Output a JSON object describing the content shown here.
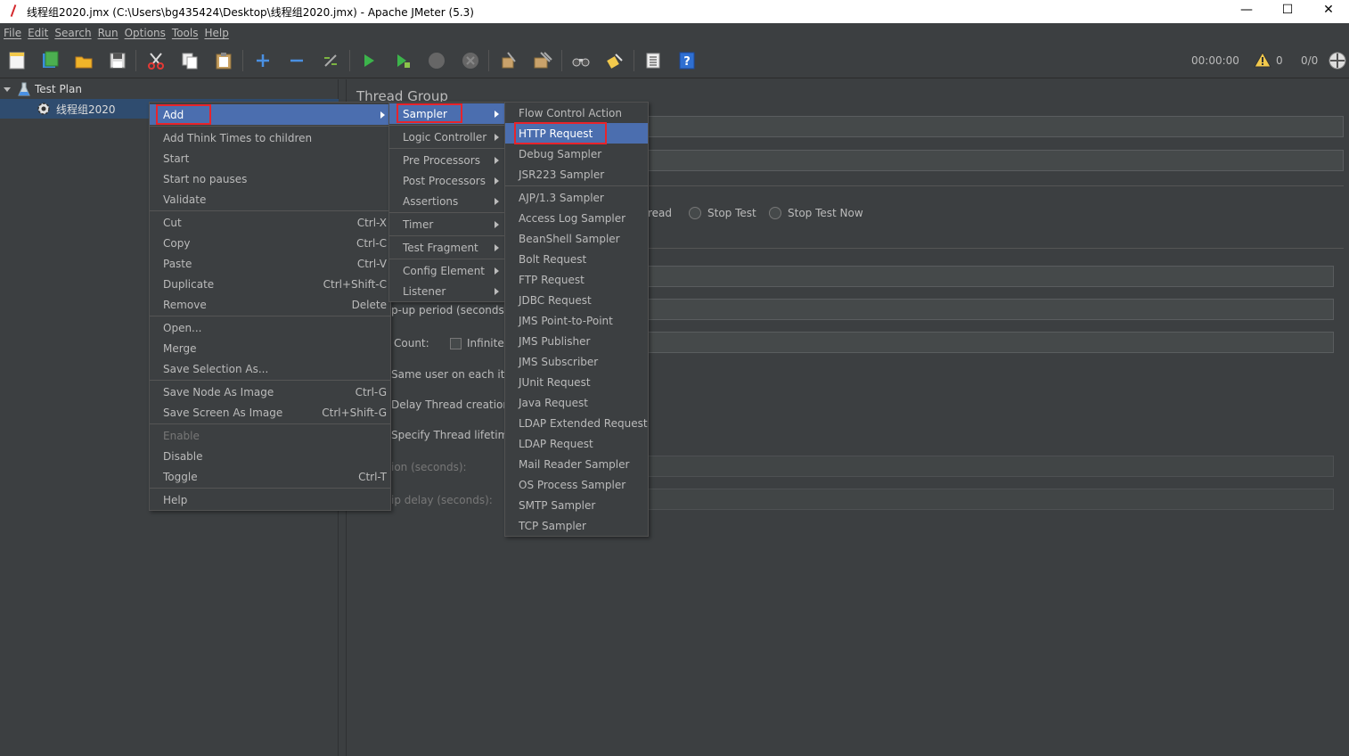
{
  "window": {
    "title": "线程组2020.jmx (C:\\Users\\bg435424\\Desktop\\线程组2020.jmx) - Apache JMeter (5.3)",
    "minimize": "—",
    "maximize": "☐",
    "close": "✕"
  },
  "menubar": [
    "File",
    "Edit",
    "Search",
    "Run",
    "Options",
    "Tools",
    "Help"
  ],
  "status": {
    "time": "00:00:00",
    "warnings": "0",
    "threads": "0/0"
  },
  "tree": {
    "test_plan": "Test Plan",
    "thread_group": "线程组2020"
  },
  "config": {
    "title": "Thread Group",
    "thread_action_partial": "read",
    "stop_test": "Stop Test",
    "stop_test_now": "Stop Test Now",
    "rampup_partial": "p-up period (seconds):",
    "loop_count": "Count:",
    "infinite": "Infinite",
    "same_user": "Same user on each iter",
    "delay_creation": "Delay Thread creation u",
    "specify_lifetime": "Specify Thread lifetime",
    "duration_partial": "ion (seconds):",
    "startup_delay_partial": "ip delay (seconds):"
  },
  "context_menu": {
    "items": [
      {
        "label": "Add",
        "shortcut": ""
      },
      {
        "label": "Add Think Times to children",
        "shortcut": ""
      },
      {
        "label": "Start",
        "shortcut": ""
      },
      {
        "label": "Start no pauses",
        "shortcut": ""
      },
      {
        "label": "Validate",
        "shortcut": ""
      },
      {
        "label": "Cut",
        "shortcut": "Ctrl-X"
      },
      {
        "label": "Copy",
        "shortcut": "Ctrl-C"
      },
      {
        "label": "Paste",
        "shortcut": "Ctrl-V"
      },
      {
        "label": "Duplicate",
        "shortcut": "Ctrl+Shift-C"
      },
      {
        "label": "Remove",
        "shortcut": "Delete"
      },
      {
        "label": "Open...",
        "shortcut": ""
      },
      {
        "label": "Merge",
        "shortcut": ""
      },
      {
        "label": "Save Selection As...",
        "shortcut": ""
      },
      {
        "label": "Save Node As Image",
        "shortcut": "Ctrl-G"
      },
      {
        "label": "Save Screen As Image",
        "shortcut": "Ctrl+Shift-G"
      },
      {
        "label": "Enable",
        "shortcut": ""
      },
      {
        "label": "Disable",
        "shortcut": ""
      },
      {
        "label": "Toggle",
        "shortcut": "Ctrl-T"
      },
      {
        "label": "Help",
        "shortcut": ""
      }
    ]
  },
  "add_menu": {
    "items": [
      "Sampler",
      "Logic Controller",
      "Pre Processors",
      "Post Processors",
      "Assertions",
      "Timer",
      "Test Fragment",
      "Config Element",
      "Listener"
    ]
  },
  "sampler_menu": {
    "items": [
      "Flow Control Action",
      "HTTP Request",
      "Debug Sampler",
      "JSR223 Sampler",
      "AJP/1.3 Sampler",
      "Access Log Sampler",
      "BeanShell Sampler",
      "Bolt Request",
      "FTP Request",
      "JDBC Request",
      "JMS Point-to-Point",
      "JMS Publisher",
      "JMS Subscriber",
      "JUnit Request",
      "Java Request",
      "LDAP Extended Request",
      "LDAP Request",
      "Mail Reader Sampler",
      "OS Process Sampler",
      "SMTP Sampler",
      "TCP Sampler"
    ]
  },
  "colors": {
    "background": "#3c3f41",
    "selection": "#4b6eaf",
    "highlight_box": "#e8242b",
    "tree_selection": "#2f4c6f"
  }
}
